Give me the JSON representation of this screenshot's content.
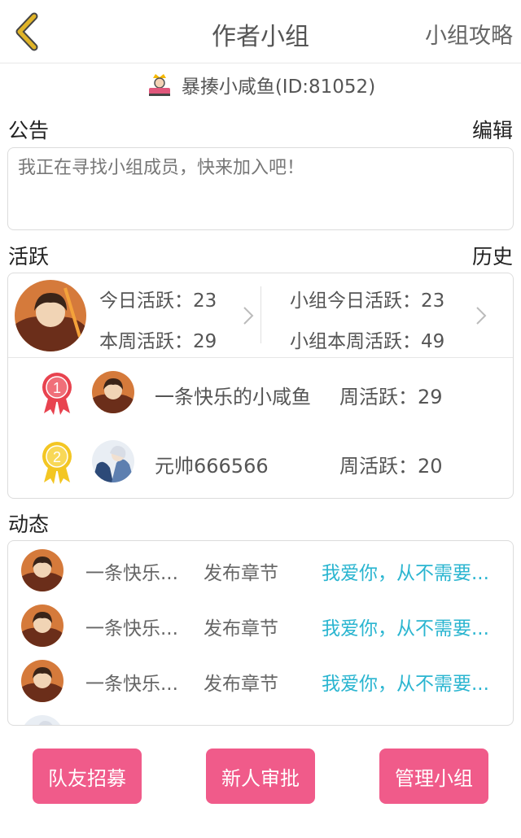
{
  "header": {
    "title": "作者小组",
    "right_link": "小组攻略"
  },
  "owner": {
    "label": "暴揍小咸鱼(ID:81052)"
  },
  "notice": {
    "label": "公告",
    "edit": "编辑",
    "text": "我正在寻找小组成员，快来加入吧！"
  },
  "activity": {
    "label": "活跃",
    "history": "历史",
    "today": "今日活跃：23",
    "week": "本周活跃：29",
    "group_today": "小组今日活跃：23",
    "group_week": "小组本周活跃：49",
    "ranking": [
      {
        "rank": "1",
        "name": "一条快乐的小咸鱼",
        "score": "周活跃：29",
        "medal_color": "#e8434f"
      },
      {
        "rank": "2",
        "name": "元帅666566",
        "score": "周活跃：20",
        "medal_color": "#f3c623"
      }
    ]
  },
  "feed": {
    "label": "动态",
    "items": [
      {
        "name": "一条快乐...",
        "action": "发布章节",
        "title": "我爱你，从不需要..."
      },
      {
        "name": "一条快乐...",
        "action": "发布章节",
        "title": "我爱你，从不需要..."
      },
      {
        "name": "一条快乐...",
        "action": "发布章节",
        "title": "我爱你，从不需要..."
      }
    ]
  },
  "buttons": {
    "recruit": "队友招募",
    "approve": "新人审批",
    "manage": "管理小组"
  },
  "colors": {
    "accent": "#f05b8a",
    "link": "#2ab5d0",
    "back_arrow": "#e0b428"
  }
}
